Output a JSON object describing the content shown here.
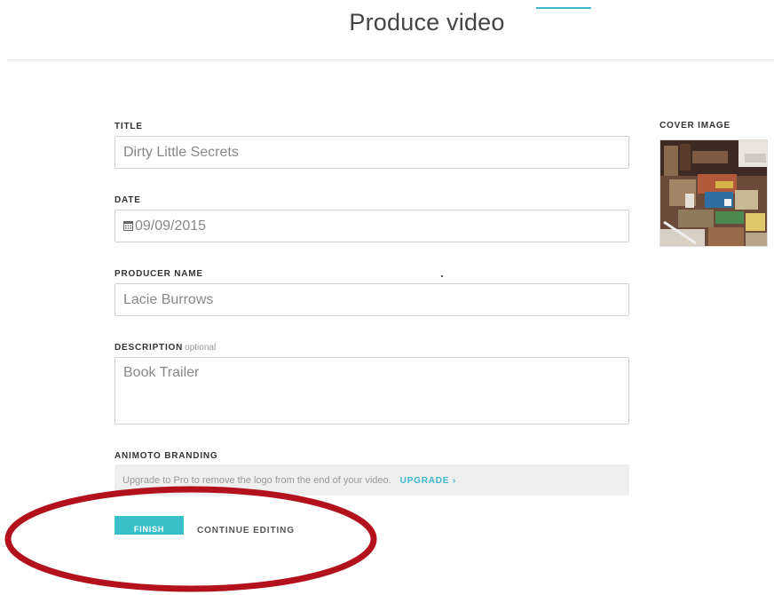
{
  "header": {
    "title": "Produce video"
  },
  "form": {
    "title_label": "TITLE",
    "title_value": "Dirty Little Secrets",
    "date_label": "DATE",
    "date_value": "09/09/2015",
    "producer_label": "PRODUCER NAME",
    "producer_value": "Lacie Burrows",
    "description_label": "DESCRIPTION",
    "description_optional": "optional",
    "description_value": "Book Trailer",
    "branding_label": "ANIMOTO BRANDING",
    "branding_text": "Upgrade to Pro to remove the logo from the end of your video.",
    "upgrade_label": "UPGRADE ›"
  },
  "cover": {
    "label": "COVER IMAGE"
  },
  "actions": {
    "finish_label": "FINISH",
    "continue_label": "CONTINUE EDITING"
  },
  "colors": {
    "accent": "#3cb8c9",
    "annotation": "#b3121c"
  },
  "icons": [
    "calendar-icon",
    "chevron-right-icon"
  ]
}
